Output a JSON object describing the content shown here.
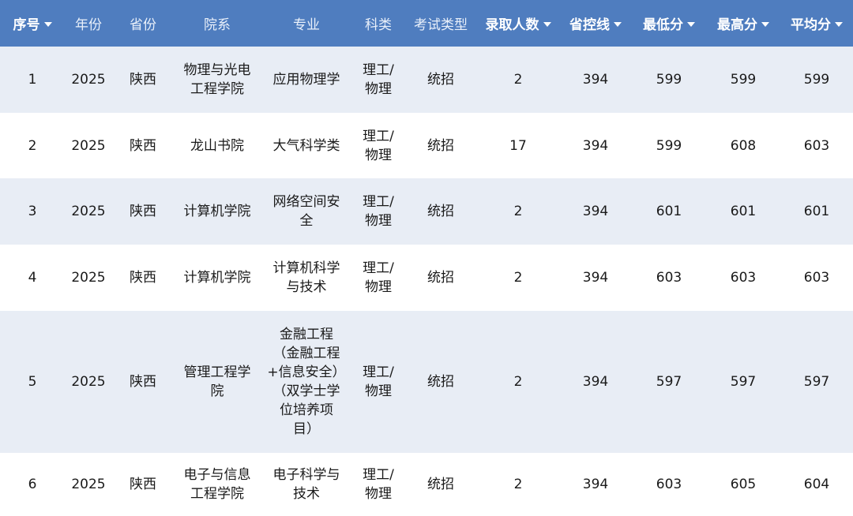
{
  "header": {
    "cols": [
      {
        "label": "序号",
        "sortable": true
      },
      {
        "label": "年份",
        "sortable": false
      },
      {
        "label": "省份",
        "sortable": false
      },
      {
        "label": "院系",
        "sortable": false
      },
      {
        "label": "专业",
        "sortable": false
      },
      {
        "label": "科类",
        "sortable": false
      },
      {
        "label": "考试类型",
        "sortable": false
      },
      {
        "label": "录取人数",
        "sortable": true
      },
      {
        "label": "省控线",
        "sortable": true
      },
      {
        "label": "最低分",
        "sortable": true
      },
      {
        "label": "最高分",
        "sortable": true
      },
      {
        "label": "平均分",
        "sortable": true
      }
    ]
  },
  "rows": [
    {
      "no": "1",
      "year": "2025",
      "province": "陕西",
      "dept": [
        "物理与光电",
        "工程学院"
      ],
      "major": [
        "应用物理学"
      ],
      "category": [
        "理工/",
        "物理"
      ],
      "exam": "统招",
      "count": "2",
      "ctrl": "394",
      "min": "599",
      "max": "599",
      "avg": "599"
    },
    {
      "no": "2",
      "year": "2025",
      "province": "陕西",
      "dept": [
        "龙山书院"
      ],
      "major": [
        "大气科学类"
      ],
      "category": [
        "理工/",
        "物理"
      ],
      "exam": "统招",
      "count": "17",
      "ctrl": "394",
      "min": "599",
      "max": "608",
      "avg": "603"
    },
    {
      "no": "3",
      "year": "2025",
      "province": "陕西",
      "dept": [
        "计算机学院"
      ],
      "major": [
        "网络空间安",
        "全"
      ],
      "category": [
        "理工/",
        "物理"
      ],
      "exam": "统招",
      "count": "2",
      "ctrl": "394",
      "min": "601",
      "max": "601",
      "avg": "601"
    },
    {
      "no": "4",
      "year": "2025",
      "province": "陕西",
      "dept": [
        "计算机学院"
      ],
      "major": [
        "计算机科学",
        "与技术"
      ],
      "category": [
        "理工/",
        "物理"
      ],
      "exam": "统招",
      "count": "2",
      "ctrl": "394",
      "min": "603",
      "max": "603",
      "avg": "603"
    },
    {
      "no": "5",
      "year": "2025",
      "province": "陕西",
      "dept": [
        "管理工程学",
        "院"
      ],
      "major": [
        "金融工程",
        "（金融工程",
        "+信息安全）",
        "（双学士学",
        "位培养项",
        "目）"
      ],
      "category": [
        "理工/",
        "物理"
      ],
      "exam": "统招",
      "count": "2",
      "ctrl": "394",
      "min": "597",
      "max": "597",
      "avg": "597"
    },
    {
      "no": "6",
      "year": "2025",
      "province": "陕西",
      "dept": [
        "电子与信息",
        "工程学院"
      ],
      "major": [
        "电子科学与",
        "技术"
      ],
      "category": [
        "理工/",
        "物理"
      ],
      "exam": "统招",
      "count": "2",
      "ctrl": "394",
      "min": "603",
      "max": "605",
      "avg": "604"
    }
  ]
}
